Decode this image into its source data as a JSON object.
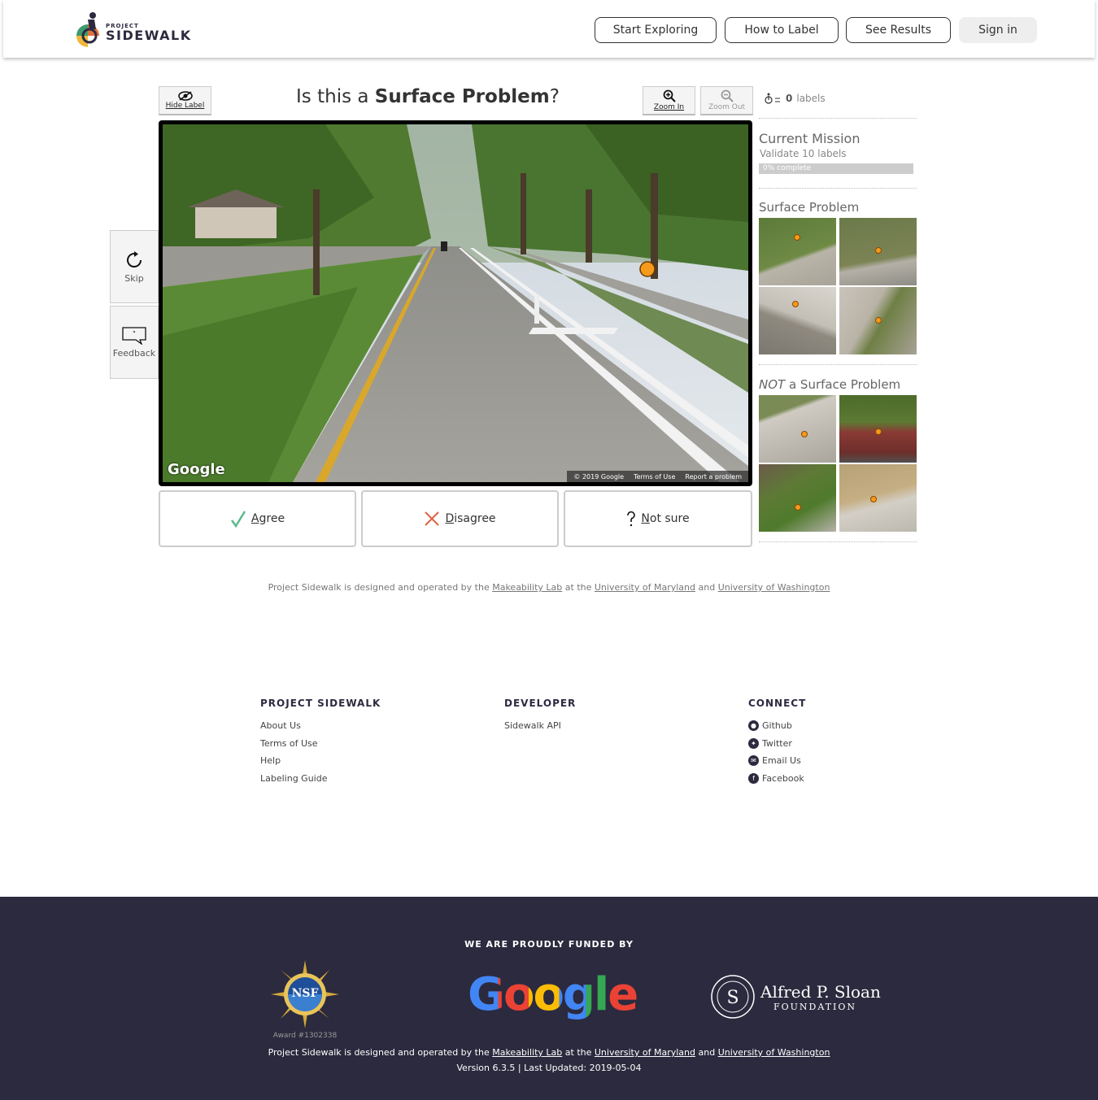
{
  "header": {
    "logo_small": "PROJECT",
    "logo_big": "SIDEWALK",
    "nav": [
      "Start Exploring",
      "How to Label",
      "See Results"
    ],
    "sign_in": "Sign in"
  },
  "tool": {
    "hide_label": "Hide Label",
    "question_prefix": "Is this a ",
    "question_label_type": "Surface Problem",
    "question_suffix": "?",
    "zoom_in": "Zoom In",
    "zoom_out": "Zoom Out",
    "skip": "Skip",
    "feedback": "Feedback",
    "pano_logo": "Google",
    "pano_footer": [
      "© 2019 Google",
      "Terms of Use",
      "Report a problem"
    ],
    "agree": "Agree",
    "disagree": "Disagree",
    "not_sure": "Not sure"
  },
  "right_panel": {
    "label_count": "0",
    "label_count_suffix": "labels",
    "mission_title": "Current Mission",
    "mission_desc": "Validate 10 labels",
    "mission_progress_text": "0% complete",
    "mission_progress": 0,
    "examples_title": "Surface Problem",
    "counter_examples_title_em": "NOT",
    "counter_examples_title_rest": " a Surface Problem"
  },
  "credit": {
    "prefix": "Project Sidewalk is designed and operated by the ",
    "lab": "Makeability Lab",
    "mid1": " at the ",
    "umd": "University of Maryland",
    "mid2": " and ",
    "uw": "University of Washington"
  },
  "footer": {
    "col1_title": "PROJECT SIDEWALK",
    "col1_links": [
      "About Us",
      "Terms of Use",
      "Help",
      "Labeling Guide"
    ],
    "col2_title": "DEVELOPER",
    "col2_links": [
      "Sidewalk API"
    ],
    "col3_title": "CONNECT",
    "col3_links": [
      "Github",
      "Twitter",
      "Email Us",
      "Facebook"
    ]
  },
  "funded": {
    "title": "WE ARE PROUDLY FUNDED BY",
    "nsf_text": "NSF",
    "nsf_award": "Award #1302338",
    "google": "Google",
    "sloan_line1": "Alfred P. Sloan",
    "sloan_line2": "FOUNDATION",
    "version": "Version 6.3.5 | Last Updated: 2019-05-04"
  }
}
